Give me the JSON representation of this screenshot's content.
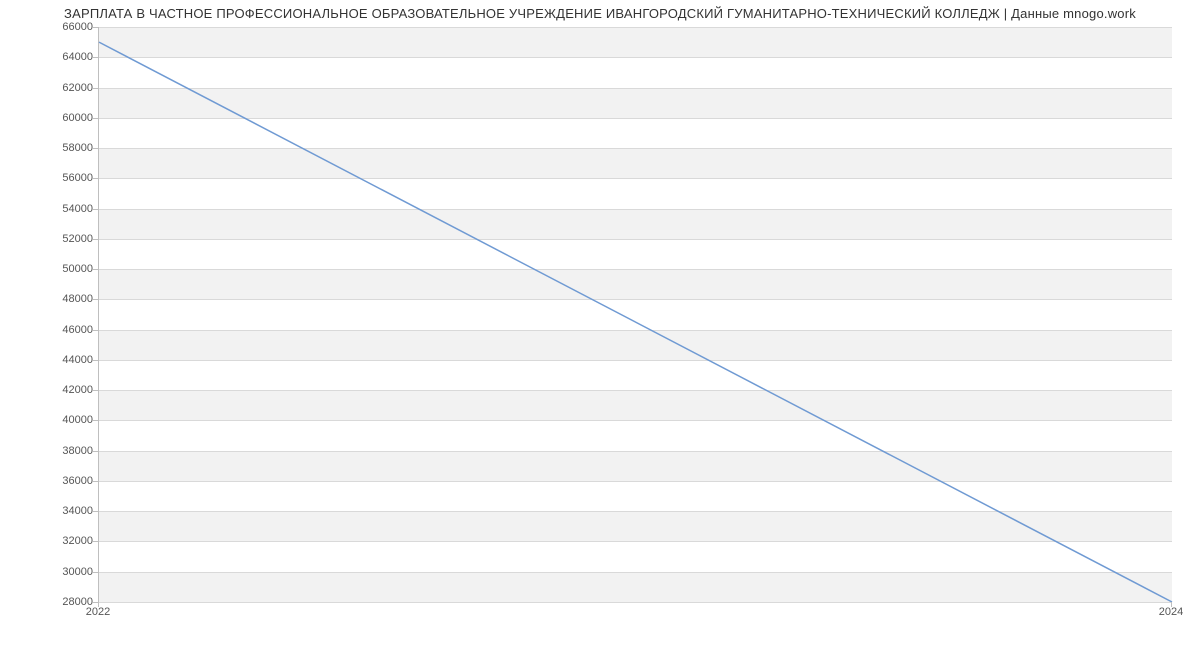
{
  "chart_data": {
    "type": "line",
    "title": "ЗАРПЛАТА В ЧАСТНОЕ ПРОФЕССИОНАЛЬНОЕ ОБРАЗОВАТЕЛЬНОЕ УЧРЕЖДЕНИЕ ИВАНГОРОДСКИЙ ГУМАНИТАРНО-ТЕХНИЧЕСКИЙ КОЛЛЕДЖ | Данные mnogo.work",
    "x": [
      2022,
      2024
    ],
    "values": [
      65000,
      28000
    ],
    "xlabel": "",
    "ylabel": "",
    "x_ticks": [
      2022,
      2024
    ],
    "y_ticks": [
      28000,
      30000,
      32000,
      34000,
      36000,
      38000,
      40000,
      42000,
      44000,
      46000,
      48000,
      50000,
      52000,
      54000,
      56000,
      58000,
      60000,
      62000,
      64000,
      66000
    ],
    "ylim": [
      28000,
      66000
    ],
    "xlim": [
      2022,
      2024
    ],
    "line_color": "#6f9ad3"
  }
}
